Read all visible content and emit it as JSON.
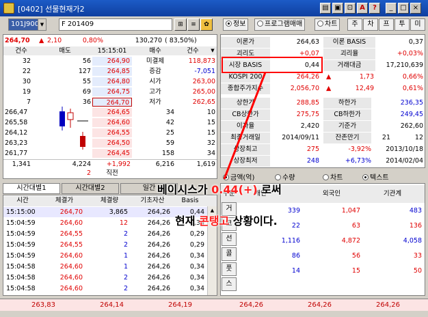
{
  "window": {
    "title": "[0402] 선물현재가2",
    "controls": [
      "□",
      "▣",
      "🔒",
      "A",
      "?",
      "_",
      "□",
      "×"
    ]
  },
  "toolbar": {
    "code": "101J9000",
    "name": "F 201409",
    "info_tab": "정보",
    "program_tab": "프로그램매매",
    "chart_tab": "차트",
    "nav": [
      "주",
      "차",
      "프",
      "투",
      "미"
    ]
  },
  "quote": {
    "price": "264,70",
    "change": "2,10",
    "rate": "0,80%",
    "volume": "130,270",
    "vol_rate": "83,50%",
    "up_arrow": "▲"
  },
  "orderbook": {
    "headers": [
      "건수",
      "매도",
      "15:15:01",
      "매수",
      "건수"
    ],
    "sell_rows": [
      {
        "cnt": "32",
        "qty": "56",
        "price": "264,90",
        "label": "미결제",
        "val": "118,873"
      },
      {
        "cnt": "22",
        "qty": "127",
        "price": "264,85",
        "label": "증감",
        "val": "-7,051"
      },
      {
        "cnt": "30",
        "qty": "55",
        "price": "264,80",
        "label": "시가",
        "val": "263,00"
      },
      {
        "cnt": "19",
        "qty": "69",
        "price": "264,75",
        "label": "고가",
        "val": "265,00"
      },
      {
        "cnt": "7",
        "qty": "36",
        "price": "264,70",
        "label": "저가",
        "val": "262,65"
      }
    ],
    "buy_rows": [
      {
        "left": "266,47",
        "price": "264,65",
        "qty": "34",
        "cnt": "10"
      },
      {
        "left": "265,58",
        "price": "264,60",
        "qty": "42",
        "cnt": "15"
      },
      {
        "left": "264,12",
        "price": "264,55",
        "qty": "25",
        "cnt": "15"
      },
      {
        "left": "263,23",
        "price": "264,50",
        "qty": "59",
        "cnt": "32"
      },
      {
        "left": "261,77",
        "price": "264,45",
        "qty": "158",
        "cnt": "34"
      }
    ],
    "totals": {
      "cnt_sell": "1,341",
      "qty_sell": "4,224",
      "diff": "+1,992",
      "qty_buy": "6,216",
      "cnt_buy": "1,619"
    },
    "pre": {
      "qty": "2",
      "label": "직전"
    }
  },
  "info": {
    "rows": [
      {
        "l1": "이론가",
        "v1": "264,63",
        "l2": "이론 BASIS",
        "v2": "0,37"
      },
      {
        "l1": "괴리도",
        "v1": "+0,07",
        "l2": "괴리율",
        "v2": "+0,03%"
      },
      {
        "l1": "시장 BASIS",
        "v1": "0,44",
        "l2": "거래대금",
        "v2": "17,210,639"
      },
      {
        "l1": "KOSPI 200",
        "v1": "264,26",
        "l2": "▲",
        "v2a": "1,73",
        "v2": "0,66%"
      },
      {
        "l1": "종합주가지수",
        "v1": "2,056,70",
        "l2": "▲",
        "v2a": "12,49",
        "v2": "0,61%"
      }
    ],
    "rows2": [
      {
        "l1": "상한가",
        "v1": "288,85",
        "l2": "하한가",
        "v2": "236,35"
      },
      {
        "l1": "CB상한가",
        "v1": "275,75",
        "l2": "CB하한가",
        "v2": "249,45"
      },
      {
        "l1": "이자율",
        "v1": "2,420",
        "l2": "기준가",
        "v2": "262,60"
      },
      {
        "l1": "최종거래일",
        "v1": "2014/09/11",
        "l2": "잔존만기",
        "v2a": "21",
        "v2": "12"
      },
      {
        "l1": "상장최고",
        "v1": "275",
        "l2": "-3,92%",
        "v2": "2013/10/18"
      },
      {
        "l1": "상장최저",
        "v1": "248",
        "l2": "+6,73%",
        "v2": "2014/02/04"
      }
    ]
  },
  "tabs": {
    "t1": "시간대별1",
    "t2": "시간대별2",
    "t3": "일간"
  },
  "time_table": {
    "headers": [
      "시간",
      "체결가",
      "체결량",
      "기초자산",
      "Basis"
    ],
    "rows": [
      {
        "t": "15:15:00",
        "p": "264,70",
        "q": "3,865",
        "b": "264,26",
        "bs": "0,44"
      },
      {
        "t": "15:04:59",
        "p": "264,60",
        "q": "12",
        "b": "264,26",
        "bs": "0,34"
      },
      {
        "t": "15:04:59",
        "p": "264,55",
        "q": "2",
        "b": "264,26",
        "bs": "0,29"
      },
      {
        "t": "15:04:59",
        "p": "264,55",
        "q": "2",
        "b": "264,26",
        "bs": "0,29"
      },
      {
        "t": "15:04:59",
        "p": "264,60",
        "q": "1",
        "b": "264,26",
        "bs": "0,34"
      },
      {
        "t": "15:04:58",
        "p": "264,60",
        "q": "1",
        "b": "264,26",
        "bs": "0,34"
      },
      {
        "t": "15:04:58",
        "p": "264,60",
        "q": "2",
        "b": "264,26",
        "bs": "0,34"
      },
      {
        "t": "15:04:58",
        "p": "264,60",
        "q": "2",
        "b": "264,26",
        "bs": "0,34"
      }
    ]
  },
  "investor": {
    "radio1": "금액(억)",
    "radio2": "수량",
    "radio3": "차트",
    "radio4": "텍스트",
    "headers": [
      "구분",
      "개인",
      "외국인",
      "기관계"
    ],
    "side": [
      "거",
      "코",
      "선",
      "콜",
      "풋",
      "스"
    ],
    "rows": [
      {
        "a": "339",
        "b": "1,047",
        "c": "483"
      },
      {
        "a": "22",
        "b": "63",
        "c": "136"
      },
      {
        "a": "1,116",
        "b": "4,872",
        "c": "4,058"
      },
      {
        "a": "86",
        "b": "56",
        "c": "33"
      },
      {
        "a": "14",
        "b": "15",
        "c": "50"
      },
      {
        "a": "",
        "b": "",
        "c": ""
      }
    ]
  },
  "bottom": [
    "263,83",
    "264,14",
    "264,19",
    "264,26",
    "264,26",
    "264,26"
  ],
  "overlay": {
    "line1a": "베이시스가 ",
    "line1b": "0.44(+)",
    "line1c": " 로써",
    "line2a": "현재 ",
    "line2b": "콘탱고",
    "line2c": " 상황이다."
  },
  "colors": {
    "up": "#e00000",
    "down": "#0000d0",
    "highlight": "#ff0000"
  }
}
